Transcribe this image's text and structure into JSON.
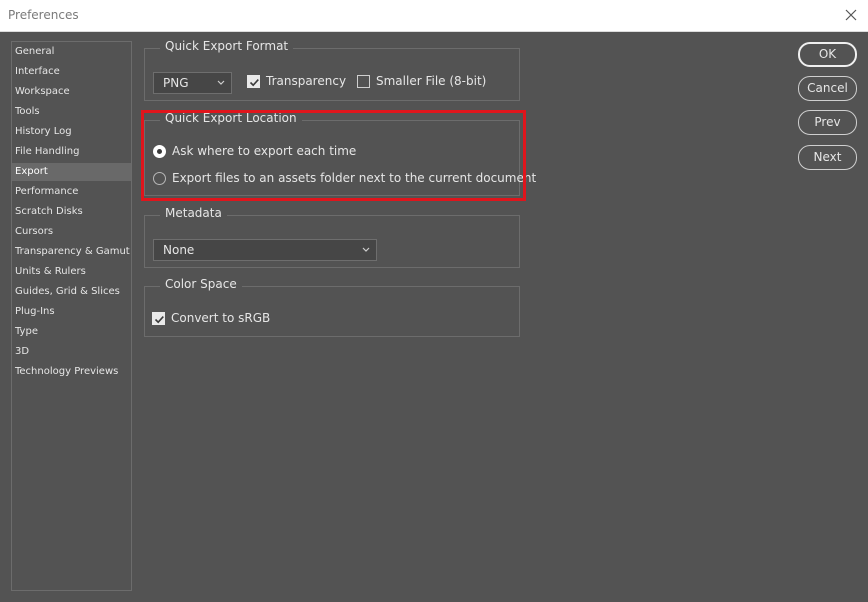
{
  "window": {
    "title": "Preferences"
  },
  "sidebar": {
    "items": [
      {
        "label": "General"
      },
      {
        "label": "Interface"
      },
      {
        "label": "Workspace"
      },
      {
        "label": "Tools"
      },
      {
        "label": "History Log"
      },
      {
        "label": "File Handling"
      },
      {
        "label": "Export"
      },
      {
        "label": "Performance"
      },
      {
        "label": "Scratch Disks"
      },
      {
        "label": "Cursors"
      },
      {
        "label": "Transparency & Gamut"
      },
      {
        "label": "Units & Rulers"
      },
      {
        "label": "Guides, Grid & Slices"
      },
      {
        "label": "Plug-Ins"
      },
      {
        "label": "Type"
      },
      {
        "label": "3D"
      },
      {
        "label": "Technology Previews"
      }
    ],
    "active_label": "Export"
  },
  "quick_export_format": {
    "legend": "Quick Export Format",
    "format_value": "PNG",
    "transparency_label": "Transparency",
    "transparency_checked": true,
    "smaller_file_label": "Smaller File (8-bit)",
    "smaller_file_checked": false
  },
  "quick_export_location": {
    "legend": "Quick Export Location",
    "options": [
      {
        "label": "Ask where to export each time",
        "selected": true
      },
      {
        "label": "Export files to an assets folder next to the current document",
        "selected": false
      }
    ],
    "highlight_color": "#e0151c"
  },
  "metadata": {
    "legend": "Metadata",
    "value": "None"
  },
  "color_space": {
    "legend": "Color Space",
    "convert_label": "Convert to sRGB",
    "convert_checked": true
  },
  "buttons": {
    "ok": "OK",
    "cancel": "Cancel",
    "prev": "Prev",
    "next": "Next"
  },
  "icons": {
    "close": "close-icon",
    "chevron": "chevron-down-icon",
    "check": "checkmark-icon"
  }
}
